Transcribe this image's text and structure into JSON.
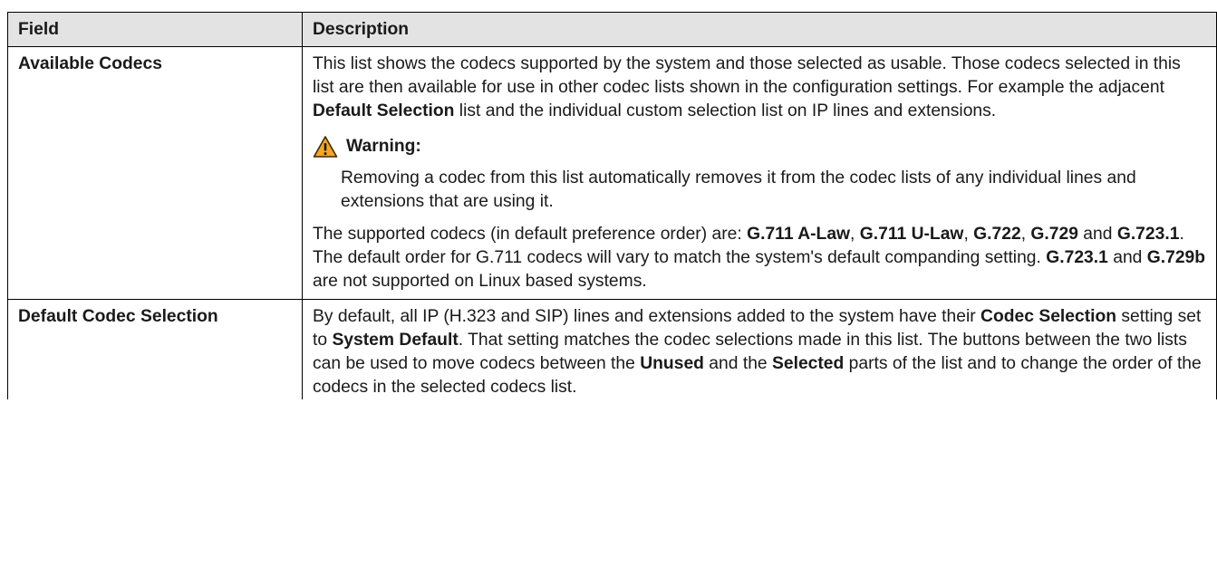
{
  "table": {
    "headers": {
      "field": "Field",
      "description": "Description"
    },
    "rows": [
      {
        "field": "Available Codecs",
        "p1": {
          "t1": "This list shows the codecs supported by the system and those selected as usable. Those codecs selected in this list are then available for use in other codec lists shown in the configuration settings. For example the adjacent ",
          "b1": "Default Selection",
          "t2": " list and the individual custom selection list on IP lines and extensions."
        },
        "warning": {
          "icon": "warning-triangle-icon",
          "title": "Warning:",
          "text": "Removing a codec from this list automatically removes it from the codec lists of any individual lines and extensions that are using it."
        },
        "p2": {
          "t1": "The supported codecs (in default preference order) are: ",
          "b1": "G.711 A-Law",
          "t2": ", ",
          "b2": "G.711 U-Law",
          "t3": ", ",
          "b3": "G.722",
          "t4": ", ",
          "b4": "G.729",
          "t5": " and ",
          "b5": "G.723.1",
          "t6": ". The default order for G.711 codecs will vary to match the system's default companding setting. ",
          "b6": "G.723.1",
          "t7": " and ",
          "b7": "G.729b",
          "t8": " are not supported on Linux based systems."
        }
      },
      {
        "field": "Default Codec Selection",
        "p1": {
          "t1": "By default, all IP (H.323 and SIP) lines and extensions added to the system have their ",
          "b1": "Codec Selection",
          "t2": " setting set to ",
          "b2": "System Default",
          "t3": ". That setting matches the codec selections made in this list. The buttons between the two lists can be used to move codecs between the ",
          "b3": "Unused",
          "t4": " and the ",
          "b4": "Selected",
          "t5": " parts of the list and to change the order of the codecs in the selected codecs list."
        }
      }
    ]
  },
  "colors": {
    "header_bg": "#e3e3e3",
    "border": "#000000",
    "warning_fill": "#f5a623"
  }
}
